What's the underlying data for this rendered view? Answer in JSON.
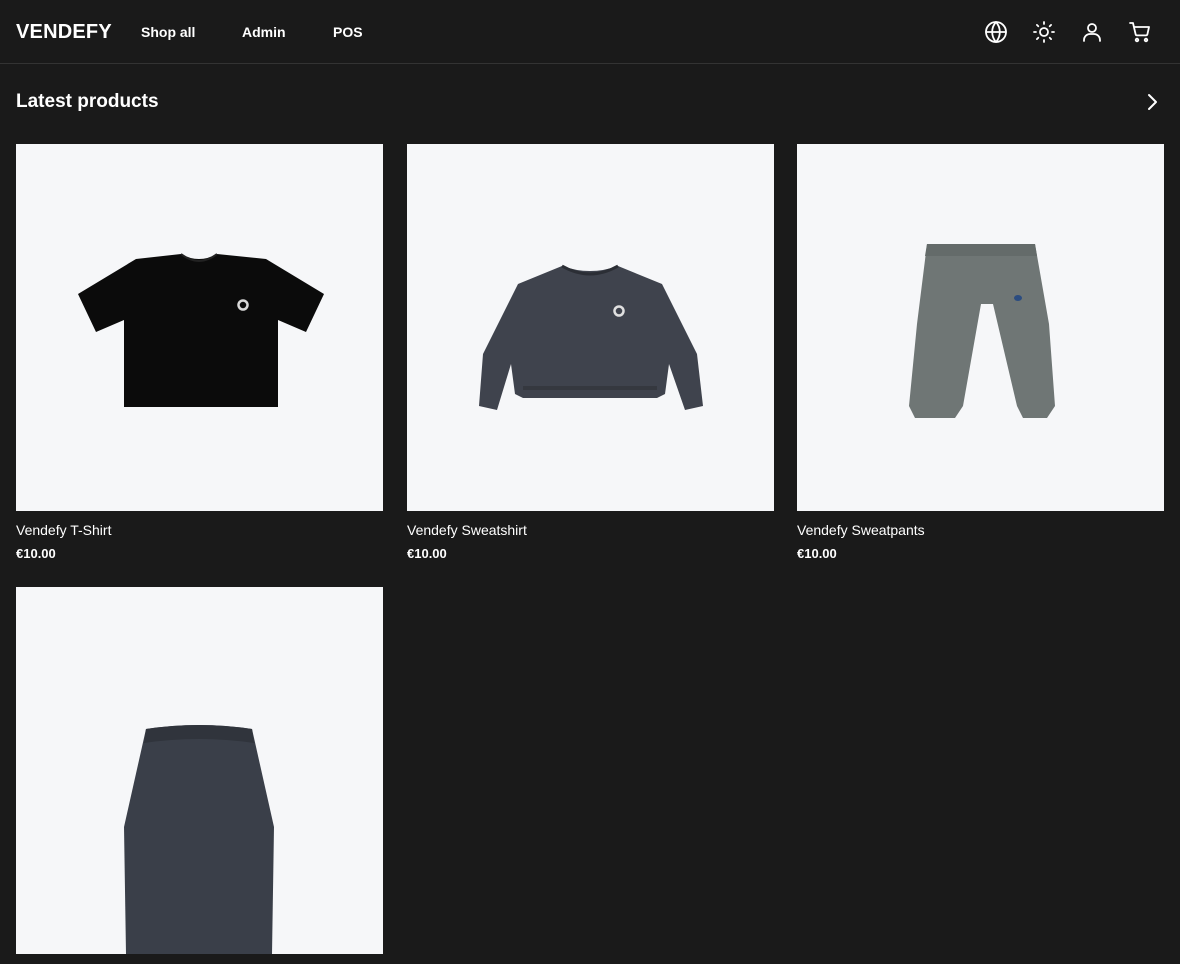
{
  "header": {
    "logo": "VENDEFY",
    "nav": [
      {
        "label": "Shop all"
      },
      {
        "label": "Admin"
      },
      {
        "label": "POS"
      }
    ],
    "icons": [
      "globe-icon",
      "sun-icon",
      "user-icon",
      "cart-icon"
    ]
  },
  "section": {
    "title": "Latest products",
    "arrow_icon": "chevron-right-icon"
  },
  "products": [
    {
      "name": "Vendefy T-Shirt",
      "price": "€10.00",
      "color": "#0b0b0b"
    },
    {
      "name": "Vendefy Sweatshirt",
      "price": "€10.00",
      "color": "#3f434d"
    },
    {
      "name": "Vendefy Sweatpants",
      "price": "€10.00",
      "color": "#6f7675"
    },
    {
      "name": "",
      "price": "",
      "color": "#3a3f49"
    }
  ],
  "colors": {
    "background": "#1a1a1a",
    "text": "#ffffff",
    "image_bg": "#f6f7f9",
    "border": "#333333"
  }
}
